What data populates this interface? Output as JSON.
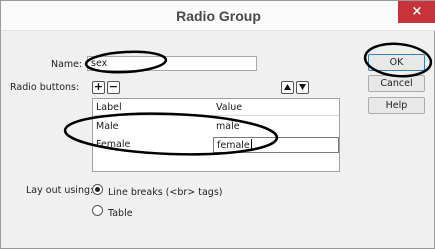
{
  "dialog": {
    "title": "Radio Group",
    "close_glyph": "×"
  },
  "form": {
    "name_label": "Name:",
    "name_value": "sex",
    "radio_buttons_label": "Radio buttons:",
    "add_glyph": "+",
    "remove_glyph": "−",
    "move_up_icon": "triangle-up-icon",
    "move_down_icon": "triangle-down-icon"
  },
  "grid": {
    "columns": [
      "Label",
      "Value"
    ],
    "rows": [
      {
        "label": "Male",
        "value": "male"
      },
      {
        "label": "Female",
        "value": "female"
      }
    ]
  },
  "layout": {
    "label": "Lay out using:",
    "options": [
      {
        "label": "Line breaks (<br> tags)",
        "selected": true
      },
      {
        "label": "Table",
        "selected": false
      }
    ]
  },
  "buttons": {
    "ok": "OK",
    "cancel": "Cancel",
    "help": "Help"
  },
  "colors": {
    "close_button": "#c7333a",
    "ok_border": "#3c7fb1",
    "annotation_ink": "#000000"
  }
}
